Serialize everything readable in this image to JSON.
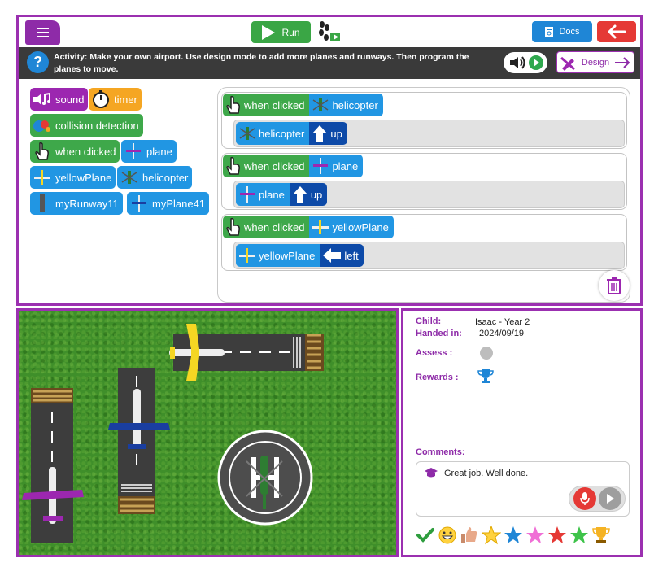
{
  "header": {
    "run_label": "Run",
    "docs_label": "Docs",
    "design_label": "Design"
  },
  "activity": {
    "text": "Activity: Make your own airport. Use design mode to add more planes and runways. Then program the planes to move."
  },
  "palette": {
    "sound": "sound",
    "timer": "timer",
    "collision": "collision detection",
    "when_clicked": "when clicked",
    "plane": "plane",
    "yellow_plane": "yellowPlane",
    "helicopter": "helicopter",
    "runway": "myRunway11",
    "plane41": "myPlane41"
  },
  "scripts": [
    {
      "event": "when clicked",
      "sprite": "helicopter",
      "action_sprite": "helicopter",
      "action": "up"
    },
    {
      "event": "when clicked",
      "sprite": "plane",
      "action_sprite": "plane",
      "action": "up"
    },
    {
      "event": "when clicked",
      "sprite": "yellowPlane",
      "action_sprite": "yellowPlane",
      "action": "left"
    }
  ],
  "feedback": {
    "child_label": "Child:",
    "child_value": "Isaac - Year 2",
    "handed_label": "Handed in:",
    "handed_value": "2024/09/19",
    "assess_label": "Assess :",
    "rewards_label": "Rewards :",
    "comments_label": "Comments:",
    "comment_text": "Great job.  Well done."
  },
  "colors": {
    "accent": "#9b30b0",
    "run_green": "#3aa645",
    "docs_blue": "#1f86d6",
    "back_red": "#e53935"
  }
}
